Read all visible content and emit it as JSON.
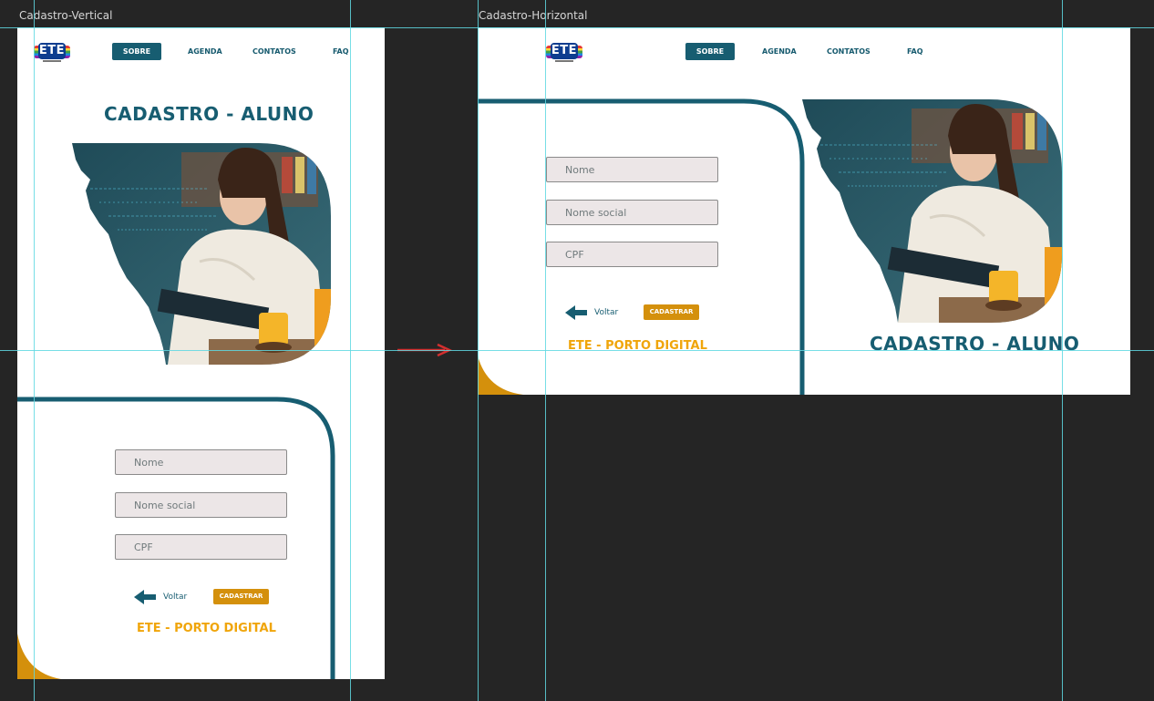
{
  "artboards": {
    "vertical_label": "Cadastro-Vertical",
    "horizontal_label": "Cadastro-Horizontal"
  },
  "logo": {
    "text": "ETE"
  },
  "nav": {
    "sobre": "SOBRE",
    "agenda": "AGENDA",
    "contatos": "CONTATOS",
    "faq": "FAQ"
  },
  "page_title": "CADASTRO - ALUNO",
  "form": {
    "nome_placeholder": "Nome",
    "nome_social_placeholder": "Nome social",
    "cpf_placeholder": "CPF"
  },
  "actions": {
    "back_label": "Voltar",
    "submit_label": "CADASTRAR"
  },
  "footer_brand": "ETE - PORTO DIGITAL",
  "colors": {
    "primary": "#175d71",
    "accent": "#d4900c",
    "brand_orange": "#f0a50a",
    "field_bg": "#ece6e7",
    "canvas": "#252525",
    "guide": "#5fd8e2",
    "flow_arrow": "#d32f2f"
  },
  "icons": {
    "back": "arrow-left-icon",
    "flow": "arrow-right-icon",
    "logo": "ete-logo-icon"
  }
}
